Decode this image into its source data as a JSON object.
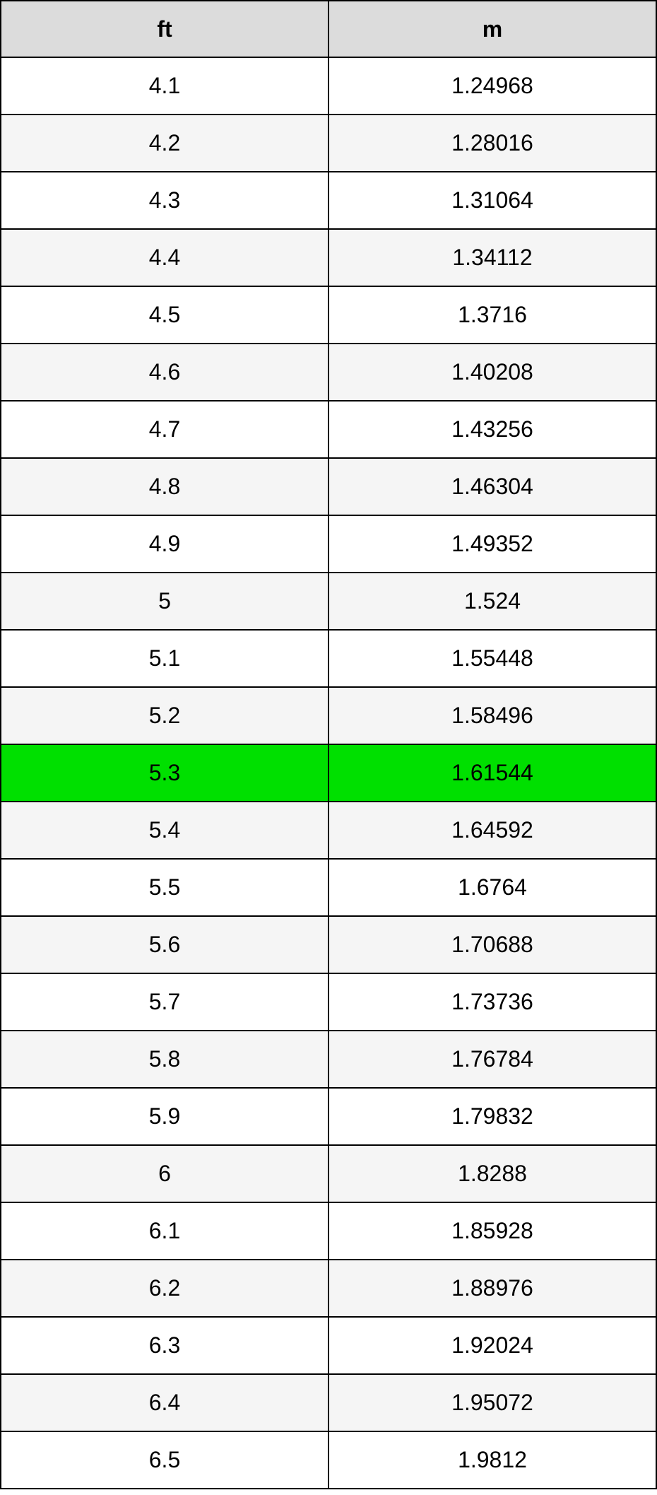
{
  "table": {
    "headers": [
      "ft",
      "m"
    ],
    "highlight_index": 12,
    "rows": [
      {
        "ft": "4.1",
        "m": "1.24968"
      },
      {
        "ft": "4.2",
        "m": "1.28016"
      },
      {
        "ft": "4.3",
        "m": "1.31064"
      },
      {
        "ft": "4.4",
        "m": "1.34112"
      },
      {
        "ft": "4.5",
        "m": "1.3716"
      },
      {
        "ft": "4.6",
        "m": "1.40208"
      },
      {
        "ft": "4.7",
        "m": "1.43256"
      },
      {
        "ft": "4.8",
        "m": "1.46304"
      },
      {
        "ft": "4.9",
        "m": "1.49352"
      },
      {
        "ft": "5",
        "m": "1.524"
      },
      {
        "ft": "5.1",
        "m": "1.55448"
      },
      {
        "ft": "5.2",
        "m": "1.58496"
      },
      {
        "ft": "5.3",
        "m": "1.61544"
      },
      {
        "ft": "5.4",
        "m": "1.64592"
      },
      {
        "ft": "5.5",
        "m": "1.6764"
      },
      {
        "ft": "5.6",
        "m": "1.70688"
      },
      {
        "ft": "5.7",
        "m": "1.73736"
      },
      {
        "ft": "5.8",
        "m": "1.76784"
      },
      {
        "ft": "5.9",
        "m": "1.79832"
      },
      {
        "ft": "6",
        "m": "1.8288"
      },
      {
        "ft": "6.1",
        "m": "1.85928"
      },
      {
        "ft": "6.2",
        "m": "1.88976"
      },
      {
        "ft": "6.3",
        "m": "1.92024"
      },
      {
        "ft": "6.4",
        "m": "1.95072"
      },
      {
        "ft": "6.5",
        "m": "1.9812"
      }
    ]
  }
}
